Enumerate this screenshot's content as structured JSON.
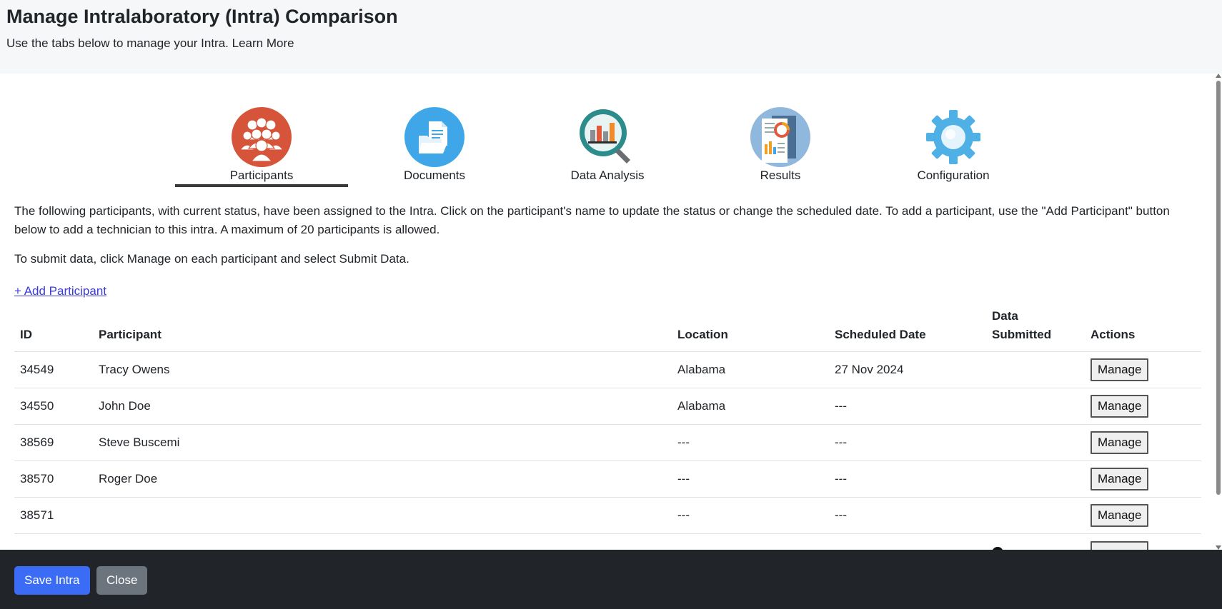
{
  "header": {
    "title": "Manage Intralaboratory (Intra) Comparison",
    "subtitle": "Use the tabs below to manage your Intra. Learn More"
  },
  "tabs": [
    {
      "label": "Participants",
      "icon": "participants-icon",
      "active": true
    },
    {
      "label": "Documents",
      "icon": "documents-icon",
      "active": false
    },
    {
      "label": "Data Analysis",
      "icon": "data-analysis-icon",
      "active": false
    },
    {
      "label": "Results",
      "icon": "results-icon",
      "active": false
    },
    {
      "label": "Configuration",
      "icon": "gear-icon",
      "active": false
    }
  ],
  "main": {
    "description": "The following participants, with current status, have been assigned to the Intra. Click on the participant's name to update the status or change the scheduled date. To add a participant, use the \"Add Participant\" button below to add a technician to this intra. A maximum of 20 participants is allowed.",
    "submit_hint": "To submit data, click Manage on each participant and select Submit Data.",
    "add_participant": "+ Add Participant"
  },
  "table": {
    "headers": {
      "id": "ID",
      "participant": "Participant",
      "location": "Location",
      "scheduled_date": "Scheduled Date",
      "data_submitted_1": "Data",
      "data_submitted_2": "Submitted",
      "actions": "Actions"
    },
    "rows": [
      {
        "id": "34549",
        "participant": "Tracy Owens",
        "location": "Alabama",
        "scheduled_date": "27 Nov 2024",
        "data_submitted": "",
        "action": "Manage"
      },
      {
        "id": "34550",
        "participant": "John Doe",
        "location": "Alabama",
        "scheduled_date": "---",
        "data_submitted": "",
        "action": "Manage"
      },
      {
        "id": "38569",
        "participant": "Steve Buscemi",
        "location": "---",
        "scheduled_date": "---",
        "data_submitted": "",
        "action": "Manage"
      },
      {
        "id": "38570",
        "participant": "Roger Doe",
        "location": "---",
        "scheduled_date": "---",
        "data_submitted": "",
        "action": "Manage"
      },
      {
        "id": "38571",
        "participant": "",
        "location": "---",
        "scheduled_date": "---",
        "data_submitted": "",
        "action": "Manage"
      }
    ]
  },
  "footer": {
    "save_label": "Save Intra",
    "close_label": "Close"
  },
  "colors": {
    "primary": "#3b6cf6",
    "secondary": "#6c757d",
    "footer_bg": "#212529",
    "header_bg": "#f6f7f9",
    "participants_icon": "#d6553a",
    "documents_icon": "#3fa7e8"
  }
}
